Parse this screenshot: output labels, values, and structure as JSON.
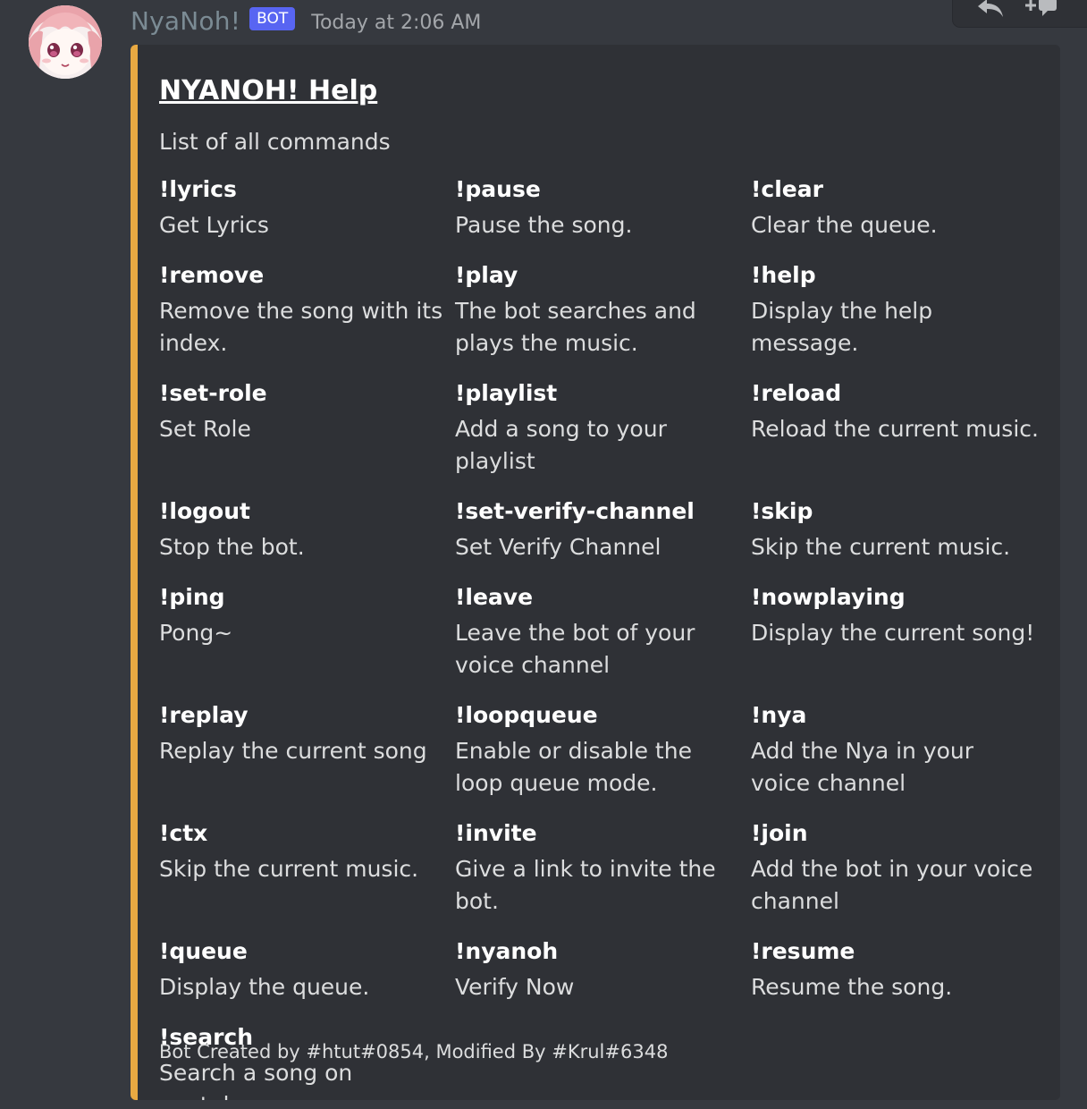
{
  "message": {
    "username": "NyaNoh!",
    "bot_tag": "BOT",
    "timestamp": "Today at 2:06 AM",
    "avatar_icon": "anime-girl-avatar",
    "toolbar": {
      "reply_icon": "reply-icon",
      "add_reaction_icon": "add-reaction-icon"
    }
  },
  "embed": {
    "accent_color": "#e8a942",
    "title": "NYANOH! Help",
    "description": "List of all commands",
    "fields": [
      {
        "name": "!lyrics",
        "value": "Get Lyrics"
      },
      {
        "name": "!pause",
        "value": "Pause the song."
      },
      {
        "name": "!clear",
        "value": "Clear the queue."
      },
      {
        "name": "!remove",
        "value": "Remove the song with its index."
      },
      {
        "name": "!play",
        "value": "The bot searches and plays the music."
      },
      {
        "name": "!help",
        "value": "Display the help message."
      },
      {
        "name": "!set-role",
        "value": "Set Role"
      },
      {
        "name": "!playlist",
        "value": "Add a song to your playlist"
      },
      {
        "name": "!reload",
        "value": "Reload the current music."
      },
      {
        "name": "!logout",
        "value": "Stop the bot."
      },
      {
        "name": "!set-verify-channel",
        "value": "Set Verify Channel"
      },
      {
        "name": "!skip",
        "value": "Skip the current music."
      },
      {
        "name": "!ping",
        "value": "Pong~"
      },
      {
        "name": "!leave",
        "value": "Leave the bot of your voice channel"
      },
      {
        "name": "!nowplaying",
        "value": "Display the current song!"
      },
      {
        "name": "!replay",
        "value": "Replay the current song"
      },
      {
        "name": "!loopqueue",
        "value": "Enable or disable the loop queue mode."
      },
      {
        "name": "!nya",
        "value": "Add the Nya in your voice channel"
      },
      {
        "name": "!ctx",
        "value": "Skip the current music."
      },
      {
        "name": "!invite",
        "value": "Give a link to invite the bot."
      },
      {
        "name": "!join",
        "value": "Add the bot in your voice channel"
      },
      {
        "name": "!queue",
        "value": "Display the queue."
      },
      {
        "name": "!nyanoh",
        "value": "Verify Now"
      },
      {
        "name": "!resume",
        "value": "Resume the song."
      },
      {
        "name": "!search",
        "value": "Search a song on youtube."
      }
    ],
    "footer": "Bot Created by #htut#0854, Modified By #Krul#6348"
  }
}
